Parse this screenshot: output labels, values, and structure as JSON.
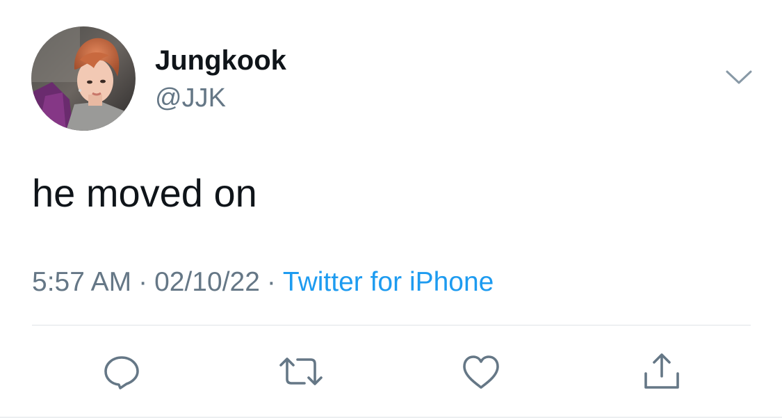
{
  "author": {
    "display_name": "Jungkook",
    "handle": "@JJK"
  },
  "tweet": {
    "text": "he moved on",
    "time": "5:57 AM",
    "date": "02/10/22",
    "source": "Twitter for iPhone",
    "separator": "·"
  },
  "icons": {
    "menu": "chevron-down-icon",
    "reply": "reply-icon",
    "retweet": "retweet-icon",
    "like": "heart-icon",
    "share": "share-icon"
  },
  "colors": {
    "name": "#0f1419",
    "secondary": "#657786",
    "link": "#1d9bf0",
    "divider": "#dfe3e6"
  }
}
